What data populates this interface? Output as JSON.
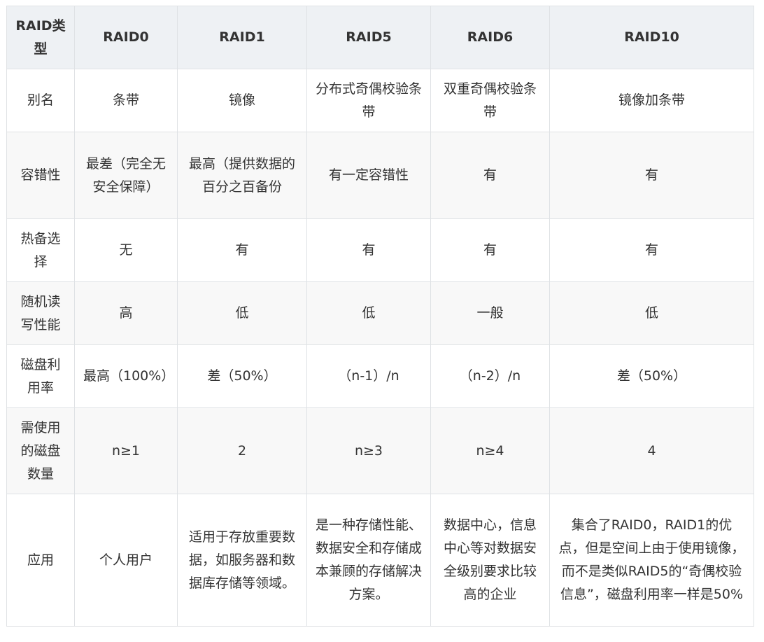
{
  "table": {
    "headers": [
      "RAID类型",
      "RAID0",
      "RAID1",
      "RAID5",
      "RAID6",
      "RAID10"
    ],
    "rows": [
      [
        "别名",
        "条带",
        "镜像",
        "分布式奇偶校验条带",
        "双重奇偶校验条带",
        "镜像加条带"
      ],
      [
        "容错性",
        "最差（完全无安全保障）",
        "最高（提供数据的百分之百备份",
        "有一定容错性",
        "有",
        "有"
      ],
      [
        "热备选择",
        "无",
        "有",
        "有",
        "有",
        "有"
      ],
      [
        "随机读写性能",
        "高",
        "低",
        "低",
        "一般",
        "低"
      ],
      [
        "磁盘利用率",
        "最高（100%）",
        "差（50%）",
        "（n-1）/n",
        "（n-2）/n",
        "差（50%）"
      ],
      [
        "需使用的磁盘数量",
        "n≥1",
        "2",
        "n≥3",
        "n≥4",
        "4"
      ],
      [
        "应用",
        "个人用户",
        "适用于存放重要数据，如服务器和数据库存储等领域。",
        "是一种存储性能、数据安全和存储成本兼顾的存储解决方案。",
        "数据中心，信息中心等对数据安全级别要求比较高的企业",
        "集合了RAID0，RAID1的优点，但是空间上由于使用镜像，而不是类似RAID5的“奇偶校验信息”，磁盘利用率一样是50%"
      ]
    ]
  }
}
